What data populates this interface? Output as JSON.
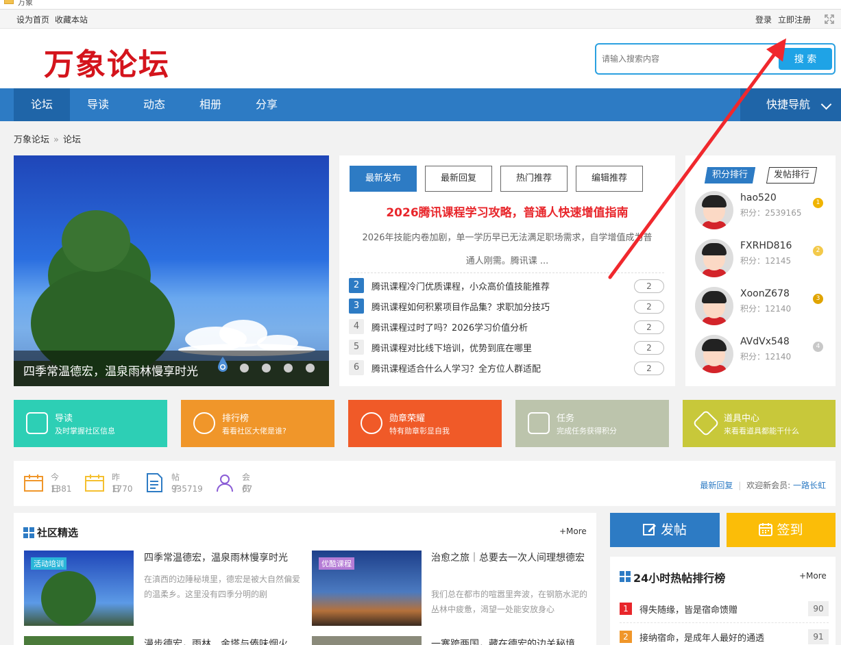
{
  "window": {
    "title": "万象"
  },
  "topbar": {
    "set_home": "设为首页",
    "bookmark": "收藏本站",
    "login": "登录",
    "register": "立即注册"
  },
  "header": {
    "logo_text": "万象论坛",
    "search_placeholder": "请输入搜索内容",
    "search_button": "搜 索"
  },
  "nav": {
    "items": [
      {
        "label": "论坛"
      },
      {
        "label": "导读"
      },
      {
        "label": "动态"
      },
      {
        "label": "相册"
      },
      {
        "label": "分享"
      }
    ],
    "quick_nav": "快捷导航"
  },
  "breadcrumb": {
    "home": "万象论坛",
    "sep": "»",
    "current": "论坛"
  },
  "slider": {
    "caption": "四季常温德宏，温泉雨林慢享时光"
  },
  "news": {
    "tabs": [
      {
        "label": "最新发布"
      },
      {
        "label": "最新回复"
      },
      {
        "label": "热门推荐"
      },
      {
        "label": "编辑推荐"
      }
    ],
    "headline": "2026腾讯课程学习攻略，普通人快速增值指南",
    "summary_line1": "2026年技能内卷加剧，单一学历早已无法满足职场需求，自学增值成为普",
    "summary_line2": "通人刚需。腾讯课 ...",
    "items": [
      {
        "num": "2",
        "title": "腾讯课程冷门优质课程，小众高价值技能推荐",
        "count": "2"
      },
      {
        "num": "3",
        "title": "腾讯课程如何积累项目作品集？求职加分技巧",
        "count": "2"
      },
      {
        "num": "4",
        "title": "腾讯课程过时了吗？2026学习价值分析",
        "count": "2"
      },
      {
        "num": "5",
        "title": "腾讯课程对比线下培训，优势到底在哪里",
        "count": "2"
      },
      {
        "num": "6",
        "title": "腾讯课程适合什么人学习？全方位人群适配",
        "count": "2"
      }
    ]
  },
  "ranking": {
    "tabs": [
      {
        "label": "积分排行"
      },
      {
        "label": "发帖排行"
      }
    ],
    "score_label": "积分：",
    "users": [
      {
        "name": "hao520",
        "score": "2539165",
        "medal": "1"
      },
      {
        "name": "FXRHD816",
        "score": "12145",
        "medal": "2"
      },
      {
        "name": "XoonZ678",
        "score": "12140",
        "medal": "3"
      },
      {
        "name": "AVdVx548",
        "score": "12140",
        "medal": "4"
      }
    ]
  },
  "feature_cards": [
    {
      "title": "导读",
      "subtitle": "及时掌握社区信息",
      "color": "#2dcfb5",
      "icon": "book-icon"
    },
    {
      "title": "排行榜",
      "subtitle": "看看社区大佬是谁?",
      "color": "#f0962a",
      "icon": "crown-icon"
    },
    {
      "title": "勋章荣耀",
      "subtitle": "特有勋章彰显自我",
      "color": "#f05a28",
      "icon": "medal-icon"
    },
    {
      "title": "任务",
      "subtitle": "完成任务获得积分",
      "color": "#bcc4ac",
      "icon": "task-icon"
    },
    {
      "title": "道具中心",
      "subtitle": "来看看道具都能干什么",
      "color": "#c8c83a",
      "icon": "tool-icon"
    }
  ],
  "stats": {
    "items": [
      {
        "label": "今日",
        "value": "1381",
        "icon": "calendar-today-icon",
        "color": "#f0962a"
      },
      {
        "label": "昨日",
        "value": "1770",
        "icon": "calendar-yesterday-icon",
        "color": "#f5c030"
      },
      {
        "label": "帖子",
        "value": "935719",
        "icon": "post-icon",
        "color": "#2d7bc4"
      },
      {
        "label": "会员",
        "value": "67",
        "icon": "member-icon",
        "color": "#8a5cd6"
      }
    ],
    "latest_reply": "最新回复",
    "welcome": "欢迎新会员:",
    "new_member": "一路长虹"
  },
  "community": {
    "title": "社区精选",
    "more": "+More",
    "posts": [
      {
        "badge": "活动培训",
        "badge_color": "#2ab6d9",
        "title": "四季常温德宏，温泉雨林慢享时光",
        "desc": "在滇西的边陲秘境里，德宏是被大自然偏爱的温柔乡。这里没有四季分明的剧"
      },
      {
        "badge": "优酷课程",
        "badge_color": "#b57cd6",
        "title": "治愈之旅｜总要去一次人间理想德宏",
        "desc": "我们总在都市的喧嚣里奔波，在钢筋水泥的丛林中疲惫，渴望一处能安放身心"
      },
      {
        "title": "漫步德宏，雨林、金塔与傣味烟火"
      },
      {
        "title": "一寨跨两国，藏在德宏的边关秘境"
      }
    ]
  },
  "actions": {
    "post": "发帖",
    "sign_in": "签到"
  },
  "hot": {
    "title": "24小时热帖排行榜",
    "more": "+More",
    "items": [
      {
        "num": "1",
        "title": "得失随缘，皆是宿命馈赠",
        "count": "90"
      },
      {
        "num": "2",
        "title": "接纳宿命，是成年人最好的通透",
        "count": "91"
      }
    ]
  }
}
